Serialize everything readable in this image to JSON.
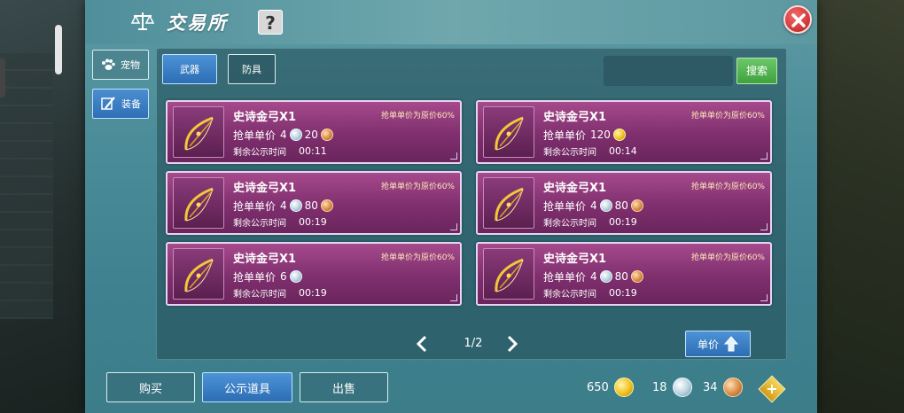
{
  "header": {
    "title": "交易所",
    "help_label": "?",
    "scale_icon": "scale-icon",
    "close_icon": "close-icon"
  },
  "side_tabs": [
    {
      "label": "宠物",
      "icon": "paw-icon"
    },
    {
      "label": "装备",
      "icon": "pen-icon"
    }
  ],
  "top_tabs": [
    {
      "label": "武器"
    },
    {
      "label": "防具"
    }
  ],
  "search": {
    "button_label": "搜索",
    "value": ""
  },
  "items": [
    {
      "name": "史诗金弓X1",
      "note": "抢单单价为原价60%",
      "price_label": "抢单单价",
      "prices": [
        {
          "amount": "4",
          "currency": "silver"
        },
        {
          "amount": "20",
          "currency": "bronze"
        }
      ],
      "time_label": "剩余公示时间",
      "time": "00:11"
    },
    {
      "name": "史诗金弓X1",
      "note": "抢单单价为原价60%",
      "price_label": "抢单单价",
      "prices": [
        {
          "amount": "120",
          "currency": "gold"
        }
      ],
      "time_label": "剩余公示时间",
      "time": "00:14"
    },
    {
      "name": "史诗金弓X1",
      "note": "抢单单价为原价60%",
      "price_label": "抢单单价",
      "prices": [
        {
          "amount": "4",
          "currency": "silver"
        },
        {
          "amount": "80",
          "currency": "bronze"
        }
      ],
      "time_label": "剩余公示时间",
      "time": "00:19"
    },
    {
      "name": "史诗金弓X1",
      "note": "抢单单价为原价60%",
      "price_label": "抢单单价",
      "prices": [
        {
          "amount": "4",
          "currency": "silver"
        },
        {
          "amount": "80",
          "currency": "bronze"
        }
      ],
      "time_label": "剩余公示时间",
      "time": "00:19"
    },
    {
      "name": "史诗金弓X1",
      "note": "抢单单价为原价60%",
      "price_label": "抢单单价",
      "prices": [
        {
          "amount": "6",
          "currency": "silver"
        }
      ],
      "time_label": "剩余公示时间",
      "time": "00:19"
    },
    {
      "name": "史诗金弓X1",
      "note": "抢单单价为原价60%",
      "price_label": "抢单单价",
      "prices": [
        {
          "amount": "4",
          "currency": "silver"
        },
        {
          "amount": "80",
          "currency": "bronze"
        }
      ],
      "time_label": "剩余公示时间",
      "time": "00:19"
    }
  ],
  "pagination": {
    "text": "1/2"
  },
  "sort_button": {
    "label": "单价"
  },
  "bottom_tabs": [
    {
      "label": "购买"
    },
    {
      "label": "公示道具"
    },
    {
      "label": "出售"
    }
  ],
  "currency": {
    "gold": "650",
    "silver": "18",
    "bronze": "34"
  },
  "colors": {
    "panel": "#4a8c98",
    "card": "#8a3678",
    "active_tab": "#2d6db4",
    "search_button": "#3fa23d",
    "close": "#d43a3a"
  }
}
